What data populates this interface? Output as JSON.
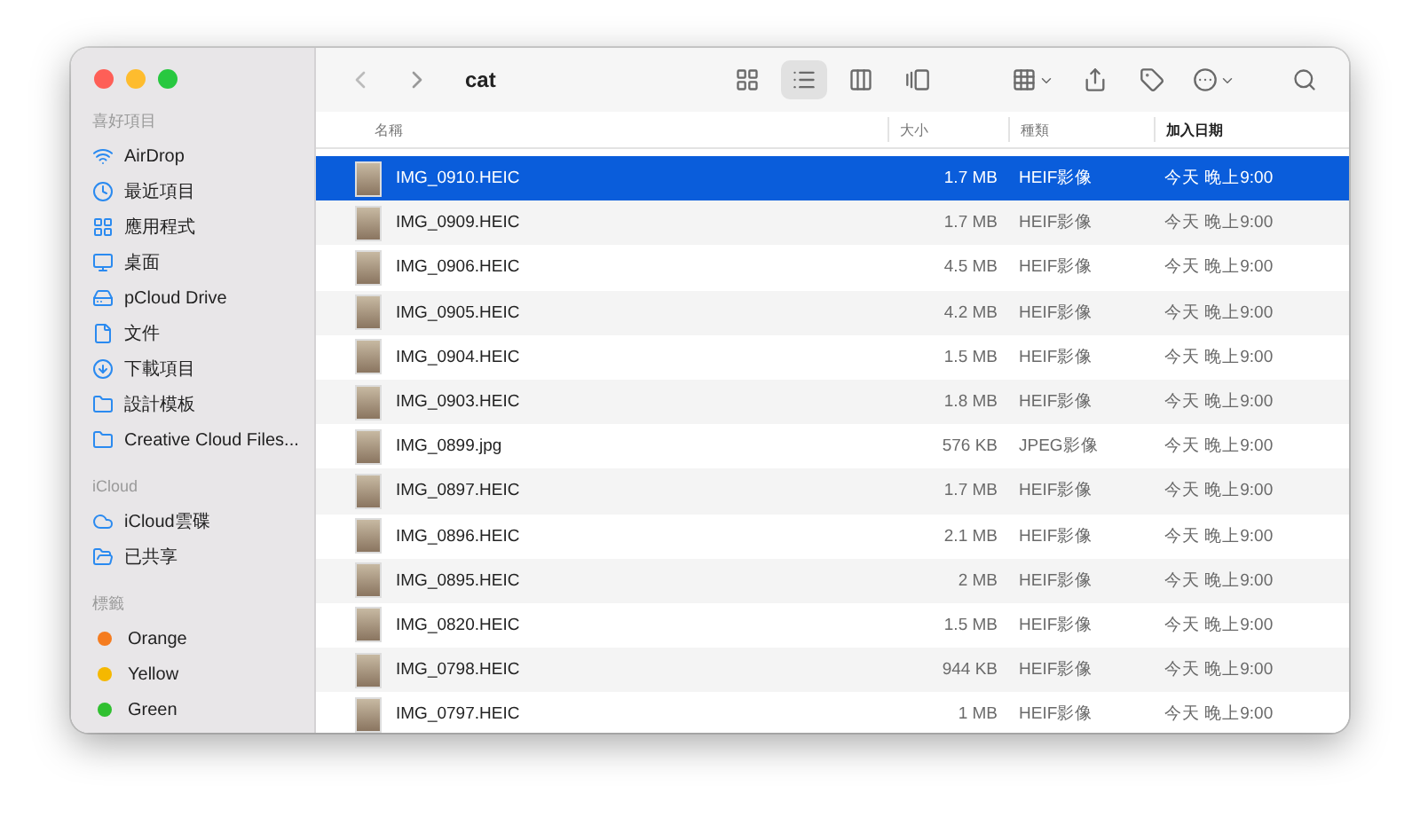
{
  "toolbar": {
    "title": "cat",
    "view_modes": [
      {
        "selected": false
      },
      {
        "selected": true
      },
      {
        "selected": false
      },
      {
        "selected": false
      }
    ]
  },
  "sidebar": {
    "sections": [
      {
        "title": "喜好項目",
        "items": [
          {
            "label": "AirDrop"
          },
          {
            "label": "最近項目"
          },
          {
            "label": "應用程式"
          },
          {
            "label": "桌面"
          },
          {
            "label": "pCloud Drive"
          },
          {
            "label": "文件"
          },
          {
            "label": "下載項目"
          },
          {
            "label": "設計模板"
          },
          {
            "label": "Creative Cloud Files..."
          }
        ]
      },
      {
        "title": "iCloud",
        "items": [
          {
            "label": "iCloud雲碟"
          },
          {
            "label": "已共享"
          }
        ]
      },
      {
        "title": "標籤",
        "items": [
          {
            "label": "Orange",
            "color": "#f57c1f"
          },
          {
            "label": "Yellow",
            "color": "#f5b800"
          },
          {
            "label": "Green",
            "color": "#30c030"
          }
        ]
      }
    ]
  },
  "table": {
    "columns": [
      {
        "label": "名稱",
        "sorted": false
      },
      {
        "label": "大小",
        "sorted": false
      },
      {
        "label": "種類",
        "sorted": false
      },
      {
        "label": "加入日期",
        "sorted": true
      }
    ],
    "rows": [
      {
        "name": "IMG_0910.HEIC",
        "size": "1.7 MB",
        "kind": "HEIF影像",
        "date": "今天 晚上9:00",
        "selected": true
      },
      {
        "name": "IMG_0909.HEIC",
        "size": "1.7 MB",
        "kind": "HEIF影像",
        "date": "今天 晚上9:00",
        "selected": false
      },
      {
        "name": "IMG_0906.HEIC",
        "size": "4.5 MB",
        "kind": "HEIF影像",
        "date": "今天 晚上9:00",
        "selected": false
      },
      {
        "name": "IMG_0905.HEIC",
        "size": "4.2 MB",
        "kind": "HEIF影像",
        "date": "今天 晚上9:00",
        "selected": false
      },
      {
        "name": "IMG_0904.HEIC",
        "size": "1.5 MB",
        "kind": "HEIF影像",
        "date": "今天 晚上9:00",
        "selected": false
      },
      {
        "name": "IMG_0903.HEIC",
        "size": "1.8 MB",
        "kind": "HEIF影像",
        "date": "今天 晚上9:00",
        "selected": false
      },
      {
        "name": "IMG_0899.jpg",
        "size": "576 KB",
        "kind": "JPEG影像",
        "date": "今天 晚上9:00",
        "selected": false
      },
      {
        "name": "IMG_0897.HEIC",
        "size": "1.7 MB",
        "kind": "HEIF影像",
        "date": "今天 晚上9:00",
        "selected": false
      },
      {
        "name": "IMG_0896.HEIC",
        "size": "2.1 MB",
        "kind": "HEIF影像",
        "date": "今天 晚上9:00",
        "selected": false
      },
      {
        "name": "IMG_0895.HEIC",
        "size": "2 MB",
        "kind": "HEIF影像",
        "date": "今天 晚上9:00",
        "selected": false
      },
      {
        "name": "IMG_0820.HEIC",
        "size": "1.5 MB",
        "kind": "HEIF影像",
        "date": "今天 晚上9:00",
        "selected": false
      },
      {
        "name": "IMG_0798.HEIC",
        "size": "944 KB",
        "kind": "HEIF影像",
        "date": "今天 晚上9:00",
        "selected": false
      },
      {
        "name": "IMG_0797.HEIC",
        "size": "1 MB",
        "kind": "HEIF影像",
        "date": "今天 晚上9:00",
        "selected": false
      }
    ]
  }
}
